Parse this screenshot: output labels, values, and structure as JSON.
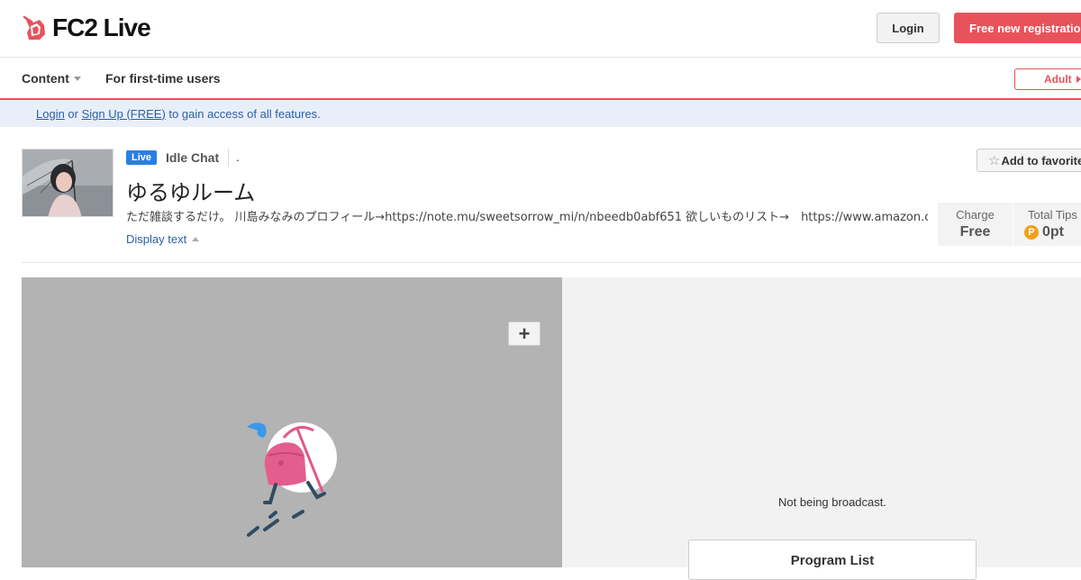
{
  "header": {
    "logo_text": "FC2 Live",
    "login_label": "Login",
    "register_label": "Free new registration"
  },
  "nav": {
    "content_label": "Content",
    "first_time_label": "For first-time users",
    "adult_label": "Adult"
  },
  "notice": {
    "login_link": "Login",
    "or_text": " or ",
    "signup_link": "Sign Up (FREE)",
    "rest_text": " to gain access of all features."
  },
  "channel": {
    "live_badge": "Live",
    "category": "Idle Chat",
    "category_extra": ".",
    "title": "ゆるゆルーム",
    "description": "ただ雑談するだけ。 川島みなみのプロフィール→https://note.mu/sweetsorrow_mi/n/nbeedb0abf651 欲しいものリスト→　https://www.amazon.co.jp/hz/",
    "display_text": "Display text",
    "favorite_label": "Add to favorites"
  },
  "stats": {
    "charge_label": "Charge",
    "charge_value": "Free",
    "tips_label": "Total Tips",
    "tips_icon": "P",
    "tips_value": "0pt"
  },
  "panel": {
    "status_text": "Not being broadcast.",
    "program_list_label": "Program List"
  },
  "colors": {
    "brand": "#e8525b",
    "live_badge": "#2b7fe0",
    "link": "#2a5fa8",
    "point": "#f2a01d"
  }
}
